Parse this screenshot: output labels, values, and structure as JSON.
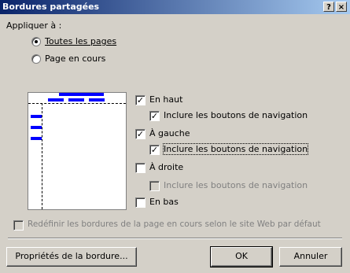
{
  "dialog": {
    "title": "Bordures partagées",
    "help_label": "?",
    "close_label": "×"
  },
  "apply_to": {
    "label": "Appliquer à :",
    "all_pages": "Toutes les pages",
    "current_page": "Page en cours",
    "selected": "all_pages"
  },
  "options": {
    "top": "En haut",
    "top_nav": "Inclure les boutons de navigation",
    "left": "À gauche",
    "left_nav": "Inclure les boutons de navigation",
    "right": "À droite",
    "right_nav": "Inclure les boutons de navigation",
    "bottom": "En bas",
    "reset": "Redéfinir les bordures de la page en cours selon le site Web par défaut"
  },
  "buttons": {
    "properties": "Propriétés de la bordure...",
    "ok": "OK",
    "cancel": "Annuler"
  },
  "colors": {
    "titlebar_start": "#0a246a",
    "titlebar_end": "#a6caf0",
    "nav_bar": "#0000ff",
    "dialog_bg": "#d4d0c8"
  }
}
